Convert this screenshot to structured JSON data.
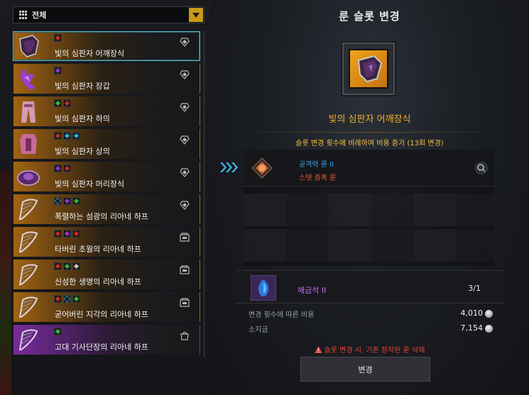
{
  "filter": {
    "label": "전체",
    "dropdown_icon": "chevron-down-icon"
  },
  "items": [
    {
      "name": "빛의 심판자 어깨장식",
      "gems": [
        "red"
      ],
      "selected": true,
      "rarity": "legendary",
      "icon": "shoulder-armor-icon",
      "equip_icon": "equip-icon"
    },
    {
      "name": "빛의 심판자 장갑",
      "gems": [
        "purple"
      ],
      "rarity": "legendary",
      "icon": "gloves-icon",
      "equip_icon": "equip-icon"
    },
    {
      "name": "빛의 심판자 하의",
      "gems": [
        "green",
        "red"
      ],
      "rarity": "legendary",
      "icon": "pants-icon",
      "equip_icon": "equip-icon"
    },
    {
      "name": "빛의 심판자 상의",
      "gems": [
        "red",
        "blue",
        "blue"
      ],
      "rarity": "legendary",
      "icon": "chest-armor-icon",
      "equip_icon": "equip-icon"
    },
    {
      "name": "빛의 심판자 머리장식",
      "gems": [
        "purple",
        "red"
      ],
      "rarity": "legendary",
      "icon": "helmet-icon",
      "equip_icon": "equip-icon"
    },
    {
      "name": "폭렬하는 섬광의 리아네 하프",
      "gems": [
        "blueout",
        "purple",
        "green"
      ],
      "rarity": "legendary",
      "icon": "harp-icon",
      "equip_icon": "equip-icon"
    },
    {
      "name": "타버린 초월의 리아네 하프",
      "gems": [
        "red",
        "purple",
        "red"
      ],
      "rarity": "legendary",
      "icon": "harp-icon",
      "equip_icon": "inventory-icon"
    },
    {
      "name": "신성한 생명의 리아네 하프",
      "gems": [
        "red",
        "green",
        "silver"
      ],
      "rarity": "legendary",
      "icon": "harp-icon",
      "equip_icon": "inventory-icon"
    },
    {
      "name": "굳어버린 지각의 리아네 하프",
      "gems": [
        "red",
        "blueout",
        "green"
      ],
      "rarity": "legendary",
      "icon": "harp-icon",
      "equip_icon": "inventory-icon"
    },
    {
      "name": "고대 기사단장의 리아네 하프",
      "gems": [
        "green"
      ],
      "rarity": "epic",
      "icon": "harp-icon",
      "equip_icon": "bag-icon"
    }
  ],
  "panel": {
    "title": "룬 슬롯 변경",
    "item_name": "빛의 심판자 어깨장식",
    "notice": "슬롯 변경 횟수에 비례하여 비용 증가 (13회 변경)",
    "rune": {
      "name": "공격력 룬 II",
      "type": "스텟 증폭 룬"
    },
    "stone": {
      "name": "해금석 II",
      "count": "3/1"
    },
    "costs": [
      {
        "label": "변경 횟수에 따른 비용",
        "value": "4,010"
      },
      {
        "label": "소지금",
        "value": "7,154"
      }
    ],
    "warning": "슬롯 변경 시, 기존 장착된 룬 삭제",
    "button": "변경"
  },
  "colors": {
    "accent": "#f0b028",
    "legendary": "#a26412",
    "epic": "#7a2a9a",
    "selected_border": "#5fb8c9",
    "rune_name": "#3fa6e6",
    "rune_type": "#e65a2e",
    "warning": "#e8453a"
  }
}
